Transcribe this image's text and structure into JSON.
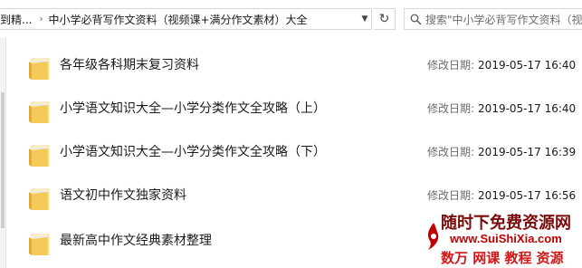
{
  "address_bar": {
    "crumbs": [
      "到精...",
      "中小学必背写作文资料（视频课+满分作文素材）大全"
    ],
    "separator": "›"
  },
  "search": {
    "placeholder": "搜索\"中小学必背写作文资料（视"
  },
  "modified_label": "修改日期:",
  "files": [
    {
      "name": "各年级各科期末复习资料",
      "modified": "2019-05-17 16:40"
    },
    {
      "name": "小学语文知识大全—小学分类作文全攻略（上）",
      "modified": "2019-05-17 16:40"
    },
    {
      "name": "小学语文知识大全—小学分类作文全攻略（下）",
      "modified": "2019-05-17 16:39"
    },
    {
      "name": "语文初中作文独家资料",
      "modified": "2019-05-17 16:56"
    },
    {
      "name": "最新高中作文经典素材整理",
      "modified": ""
    }
  ],
  "watermark": {
    "line1": "随时下免费资源网",
    "line2": "www.SuiShiXia.com",
    "line3": "数万 网课 教程 资源"
  },
  "colors": {
    "folder": "#f5c95a",
    "folder_dark": "#e0a82e",
    "watermark_red": "#c00000"
  }
}
